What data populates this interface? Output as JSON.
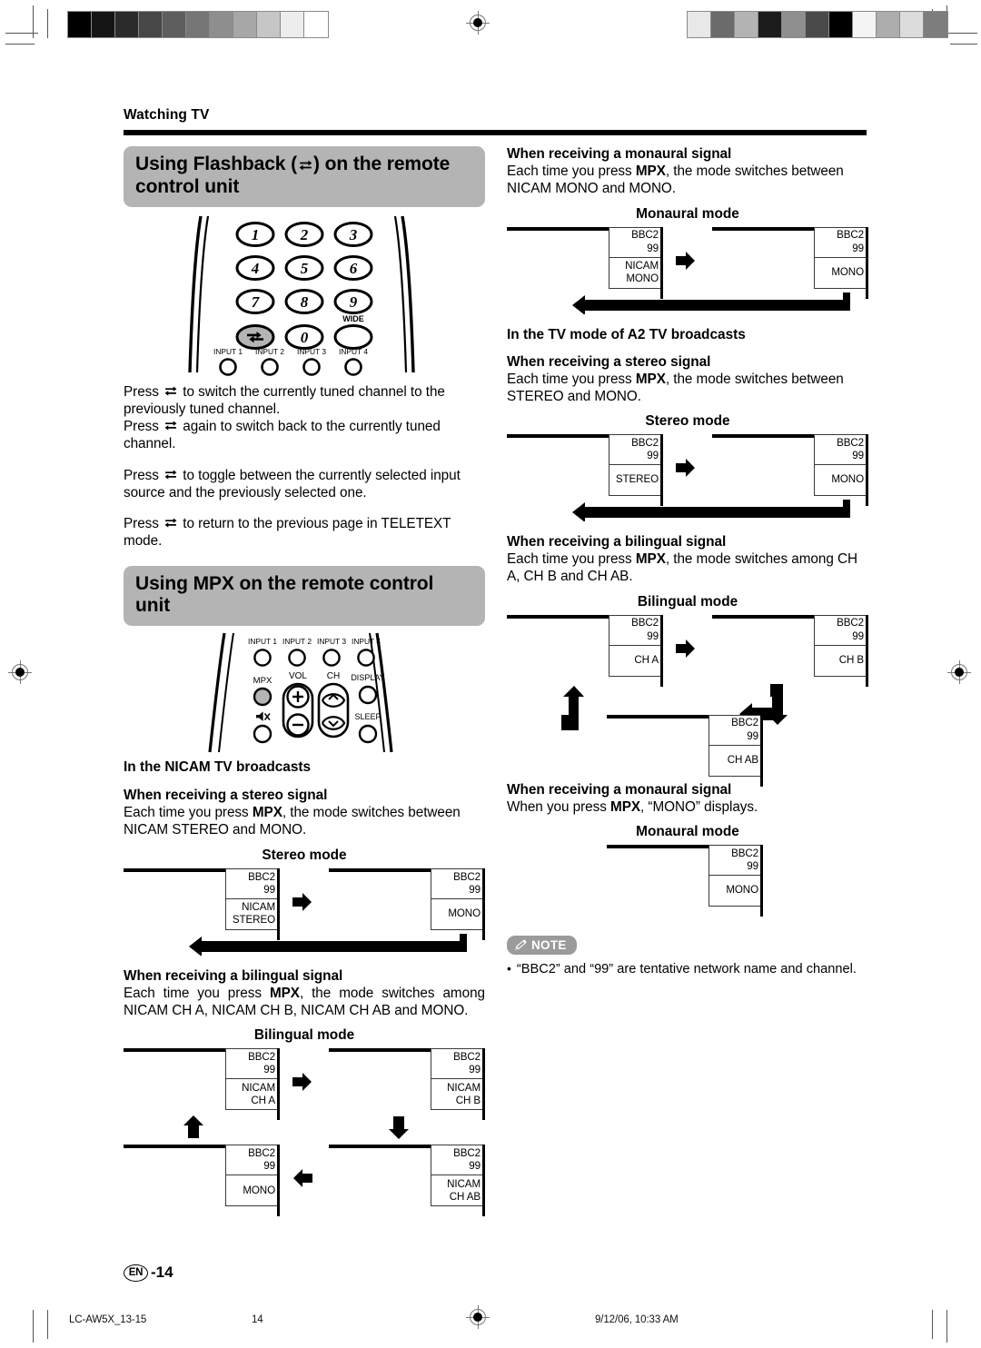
{
  "document": {
    "running_head": "Watching TV",
    "page_label": "EN",
    "page_number": "-14"
  },
  "footer": {
    "file_id": "LC-AW5X_13-15",
    "page": "14",
    "timestamp": "9/12/06, 10:33 AM"
  },
  "left_column": {
    "section_flashback": {
      "heading_before": "Using Flashback (",
      "heading_after": ") on the remote control unit",
      "icon": "flashback-icon",
      "remote": {
        "keys": [
          "1",
          "2",
          "3",
          "4",
          "5",
          "6",
          "7",
          "8",
          "9"
        ],
        "flashback_key": "flashback-icon",
        "zero_key": "0",
        "wide_label": "WIDE",
        "inputs": [
          "INPUT 1",
          "INPUT 2",
          "INPUT 3",
          "INPUT 4"
        ]
      },
      "paragraphs": [
        {
          "pre": "Press ",
          "post": " to switch the currently tuned channel to the previously tuned channel."
        },
        {
          "pre": "Press ",
          "post": " again to switch back to the currently tuned channel."
        },
        {
          "pre": "Press ",
          "post": " to toggle between the currently selected input source and the previously selected one."
        },
        {
          "pre": "Press ",
          "post": " to return to the previous page in TELETEXT mode."
        }
      ]
    },
    "section_mpx": {
      "heading": "Using MPX on the remote control unit",
      "remote": {
        "inputs": [
          "INPUT 1",
          "INPUT 2",
          "INPUT 3",
          "INPUT 4"
        ],
        "mpx_label": "MPX",
        "vol_label": "VOL",
        "ch_label": "CH",
        "display_label": "DISPLAY",
        "sleep_label": "SLEEP",
        "mute_icon": "mute-icon"
      },
      "nicam_heading": "In the NICAM TV broadcasts",
      "stereo": {
        "title": "When receiving a stereo signal",
        "body_pre": "Each time you press ",
        "body_bold": "MPX",
        "body_post": ", the mode switches between NICAM STEREO and MONO.",
        "mode_label": "Stereo mode",
        "boxes": [
          {
            "network": "BBC2",
            "channel": "99",
            "mode_line1": "NICAM",
            "mode_line2": "STEREO"
          },
          {
            "network": "BBC2",
            "channel": "99",
            "mode_line1": "",
            "mode_line2": "MONO"
          }
        ]
      },
      "bilingual": {
        "title": "When receiving a bilingual signal",
        "body_pre": "Each time you press ",
        "body_bold": "MPX",
        "body_post": ", the mode switches among NICAM CH A, NICAM CH B, NICAM CH AB and MONO.",
        "mode_label": "Bilingual mode",
        "boxes": [
          {
            "network": "BBC2",
            "channel": "99",
            "mode_line1": "NICAM",
            "mode_line2": "CH A"
          },
          {
            "network": "BBC2",
            "channel": "99",
            "mode_line1": "NICAM",
            "mode_line2": "CH B"
          },
          {
            "network": "BBC2",
            "channel": "99",
            "mode_line1": "",
            "mode_line2": "MONO"
          },
          {
            "network": "BBC2",
            "channel": "99",
            "mode_line1": "NICAM",
            "mode_line2": "CH AB"
          }
        ]
      }
    }
  },
  "right_column": {
    "nicam_monaural": {
      "title": "When receiving a monaural signal",
      "body_pre": "Each time you press ",
      "body_bold": "MPX",
      "body_post": ", the mode switches between NICAM MONO and MONO.",
      "mode_label": "Monaural mode",
      "boxes": [
        {
          "network": "BBC2",
          "channel": "99",
          "mode_line1": "NICAM",
          "mode_line2": "MONO"
        },
        {
          "network": "BBC2",
          "channel": "99",
          "mode_line1": "",
          "mode_line2": "MONO"
        }
      ]
    },
    "a2_heading": "In the TV mode of A2 TV broadcasts",
    "a2_stereo": {
      "title": "When receiving a stereo signal",
      "body_pre": "Each time you press ",
      "body_bold": "MPX",
      "body_post": ", the mode switches between STEREO and MONO.",
      "mode_label": "Stereo mode",
      "boxes": [
        {
          "network": "BBC2",
          "channel": "99",
          "mode_line1": "",
          "mode_line2": "STEREO"
        },
        {
          "network": "BBC2",
          "channel": "99",
          "mode_line1": "",
          "mode_line2": "MONO"
        }
      ]
    },
    "a2_bilingual": {
      "title": "When receiving a bilingual signal",
      "body_pre": "Each time you press ",
      "body_bold": "MPX",
      "body_post": ", the mode switches among CH A, CH B and CH AB.",
      "mode_label": "Bilingual mode",
      "boxes": [
        {
          "network": "BBC2",
          "channel": "99",
          "mode_line1": "",
          "mode_line2": "CH A"
        },
        {
          "network": "BBC2",
          "channel": "99",
          "mode_line1": "",
          "mode_line2": "CH B"
        },
        {
          "network": "BBC2",
          "channel": "99",
          "mode_line1": "",
          "mode_line2": "CH AB"
        }
      ]
    },
    "a2_monaural": {
      "title": "When receiving a monaural signal",
      "body_pre": "When you press ",
      "body_bold": "MPX",
      "body_post": ", “MONO” displays.",
      "mode_label": "Monaural mode",
      "boxes": [
        {
          "network": "BBC2",
          "channel": "99",
          "mode_line1": "",
          "mode_line2": "MONO"
        }
      ]
    },
    "note": {
      "label": "NOTE",
      "icon": "pencil-icon",
      "bullet": "•",
      "text": "“BBC2” and “99” are tentative network name and channel."
    }
  },
  "calibration": {
    "left_strip": [
      "#000000",
      "#151515",
      "#2b2b2b",
      "#474747",
      "#5e5e5e",
      "#767676",
      "#8e8e8e",
      "#a7a7a7",
      "#c6c6c6",
      "#ededed",
      "#ffffff"
    ],
    "right_strip": [
      "#e8e8e8",
      "#6b6b6b",
      "#b3b3b3",
      "#1c1c1c",
      "#8f8f8f",
      "#4a4a4a",
      "#000000",
      "#f4f4f4",
      "#adadad",
      "#dcdcdc",
      "#7d7d7d"
    ]
  },
  "colors": {
    "heading_bg": "#b4b4b4",
    "note_bg": "#9b9b9b",
    "rule": "#000000",
    "box_border": "#3a3a3a"
  }
}
